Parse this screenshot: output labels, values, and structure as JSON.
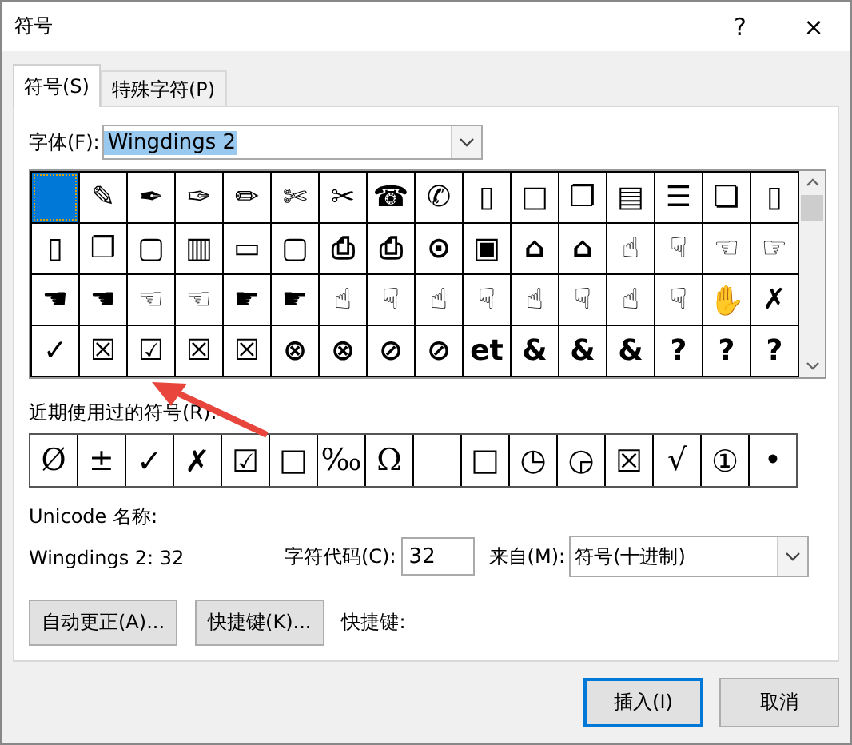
{
  "window": {
    "title": "符号",
    "help": "?",
    "close": "×"
  },
  "tabs": [
    {
      "label": "符号(S)",
      "selected": true
    },
    {
      "label": "特殊字符(P)",
      "selected": false
    }
  ],
  "font": {
    "label": "字体(F):",
    "value": "Wingdings 2",
    "text_selected": true
  },
  "symbols": [
    {
      "selected": true
    },
    {
      "glyph": "✎",
      "selected": false
    },
    {
      "glyph": "✒",
      "selected": false
    },
    {
      "glyph": "✑",
      "selected": false
    },
    {
      "glyph": "✏",
      "selected": false
    },
    {
      "glyph": "✄",
      "selected": false
    },
    {
      "glyph": "✂",
      "selected": false
    },
    {
      "glyph": "☎",
      "selected": false
    },
    {
      "glyph": "✆",
      "selected": false
    },
    {
      "glyph": "▯",
      "selected": false
    },
    {
      "glyph": "□",
      "selected": false
    },
    {
      "glyph": "❐",
      "selected": false
    },
    {
      "glyph": "▤",
      "selected": false
    },
    {
      "glyph": "☰",
      "selected": false
    },
    {
      "glyph": "❏",
      "selected": false
    },
    {
      "glyph": "▯",
      "selected": false
    },
    {
      "glyph": "▯",
      "selected": false
    },
    {
      "glyph": "❐",
      "selected": false
    },
    {
      "glyph": "▢",
      "selected": false
    },
    {
      "glyph": "▥",
      "selected": false
    },
    {
      "glyph": "▭",
      "selected": false
    },
    {
      "glyph": "▢",
      "selected": false
    },
    {
      "glyph": "⎙",
      "selected": false
    },
    {
      "glyph": "⎙",
      "selected": false
    },
    {
      "glyph": "⊙",
      "selected": false
    },
    {
      "glyph": "▣",
      "selected": false
    },
    {
      "glyph": "⌂",
      "selected": false
    },
    {
      "glyph": "⌂",
      "selected": false
    },
    {
      "glyph": "☝",
      "selected": false
    },
    {
      "glyph": "☟",
      "selected": false
    },
    {
      "glyph": "☜",
      "selected": false
    },
    {
      "glyph": "☞",
      "selected": false
    },
    {
      "glyph": "☚",
      "selected": false
    },
    {
      "glyph": "☚",
      "selected": false
    },
    {
      "glyph": "☜",
      "selected": false
    },
    {
      "glyph": "☜",
      "selected": false
    },
    {
      "glyph": "☛",
      "selected": false
    },
    {
      "glyph": "☛",
      "selected": false
    },
    {
      "glyph": "☝",
      "selected": false
    },
    {
      "glyph": "☟",
      "selected": false
    },
    {
      "glyph": "☝",
      "selected": false
    },
    {
      "glyph": "☟",
      "selected": false
    },
    {
      "glyph": "☝",
      "selected": false
    },
    {
      "glyph": "☟",
      "selected": false
    },
    {
      "glyph": "☝",
      "selected": false
    },
    {
      "glyph": "☟",
      "selected": false
    },
    {
      "glyph": "✋",
      "selected": false
    },
    {
      "glyph": "✗",
      "selected": false
    },
    {
      "glyph": "✓",
      "selected": false
    },
    {
      "glyph": "☒",
      "selected": false
    },
    {
      "glyph": "☑",
      "selected": false
    },
    {
      "glyph": "☒",
      "selected": false
    },
    {
      "glyph": "☒",
      "selected": false
    },
    {
      "glyph": "⊗",
      "selected": false
    },
    {
      "glyph": "⊗",
      "selected": false
    },
    {
      "glyph": "⊘",
      "selected": false
    },
    {
      "glyph": "⊘",
      "selected": false
    },
    {
      "glyph": "et",
      "selected": false
    },
    {
      "glyph": "&",
      "selected": false
    },
    {
      "glyph": "&",
      "selected": false
    },
    {
      "glyph": "&",
      "selected": false
    },
    {
      "glyph": "?",
      "selected": false
    },
    {
      "glyph": "?",
      "selected": false
    },
    {
      "glyph": "?",
      "selected": false
    }
  ],
  "recent_label": "近期使用过的符号(R):",
  "recent": [
    "Ø",
    "±",
    "✓",
    "✗",
    "☑",
    "□",
    "‰",
    "Ω"
  ],
  "recent_after_blank": [
    "□",
    "◷",
    "◶",
    "☒",
    "√",
    "①",
    "•"
  ],
  "unicode_name_label": "Unicode 名称:",
  "unicode_name": "Wingdings 2: 32",
  "char_code": {
    "label": "字符代码(C):",
    "value": "32"
  },
  "from": {
    "label": "来自(M):",
    "value": "符号(十进制)"
  },
  "autocorrect_button": "自动更正(A)...",
  "shortcut_button": "快捷键(K)...",
  "shortcut_label": "快捷键:",
  "buttons": [
    {
      "label": "插入(I)",
      "default": true
    },
    {
      "label": "取消",
      "default": false
    }
  ]
}
